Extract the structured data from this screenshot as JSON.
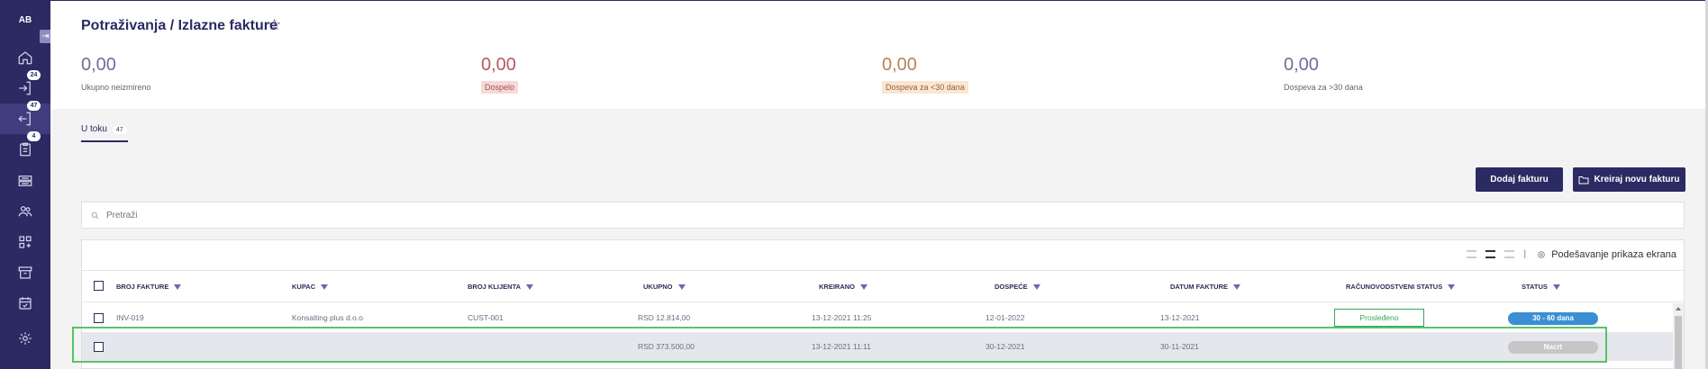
{
  "sidebar": {
    "avatar": "AB",
    "collapse_icon": "arrow-right-to-bar-icon",
    "items": [
      {
        "icon": "home-icon",
        "badge": ""
      },
      {
        "icon": "login-icon",
        "badge": "24"
      },
      {
        "icon": "logout-icon",
        "badge": "47",
        "active": true
      },
      {
        "icon": "clipboard-icon",
        "badge": "4"
      },
      {
        "icon": "transfer-icon",
        "badge": ""
      },
      {
        "icon": "users-icon",
        "badge": ""
      },
      {
        "icon": "apps-add-icon",
        "badge": ""
      },
      {
        "icon": "archive-icon",
        "badge": ""
      },
      {
        "icon": "calendar-check-icon",
        "badge": ""
      },
      {
        "icon": "settings-icon",
        "badge": ""
      }
    ]
  },
  "header": {
    "title": "Potraživanja / Izlazne fakture",
    "stats": [
      {
        "value": "0,00",
        "label": "Ukupno neizmireno"
      },
      {
        "value": "0,00",
        "label": "Dospelo"
      },
      {
        "value": "0,00",
        "label": "Dospeva za <30 dana"
      },
      {
        "value": "0,00",
        "label": "Dospeva za >30 dana"
      }
    ]
  },
  "tabs": [
    {
      "label": "U toku",
      "count": "47"
    }
  ],
  "actions": {
    "add": "Dodaj fakturu",
    "create": "Kreiraj novu fakturu"
  },
  "search": {
    "placeholder": "Pretraži"
  },
  "view": {
    "settings_label": "Podešavanje prikaza ekrana"
  },
  "table": {
    "columns": [
      "BROJ FAKTURE",
      "KUPAC",
      "BROJ KLIJENTA",
      "UKUPNO",
      "KREIRANO",
      "DOSPEĆE",
      "DATUM FAKTURE",
      "RAČUNOVODSTVENI STATUS",
      "STATUS"
    ],
    "rows": [
      {
        "invoice": "INV-019",
        "customer": "Konsalting plus d.o.o",
        "client_no": "CUST-001",
        "total": "RSD 12.814,00",
        "created": "13-12-2021 11:25",
        "due": "12-01-2022",
        "invoice_date": "13-12-2021",
        "acc_status": "Prosleđeno",
        "status": "30 - 60 dana",
        "status_color": "#3a8fd4"
      },
      {
        "invoice": "",
        "customer": "",
        "client_no": "",
        "total": "RSD 373.500,00",
        "created": "13-12-2021 11:11",
        "due": "30-12-2021",
        "invoice_date": "30-11-2021",
        "acc_status": "",
        "status": "Nacrt",
        "status_color": "#c6c6c6"
      }
    ]
  },
  "colors": {
    "brand": "#2b2a63",
    "highlight": "#53c46b"
  }
}
